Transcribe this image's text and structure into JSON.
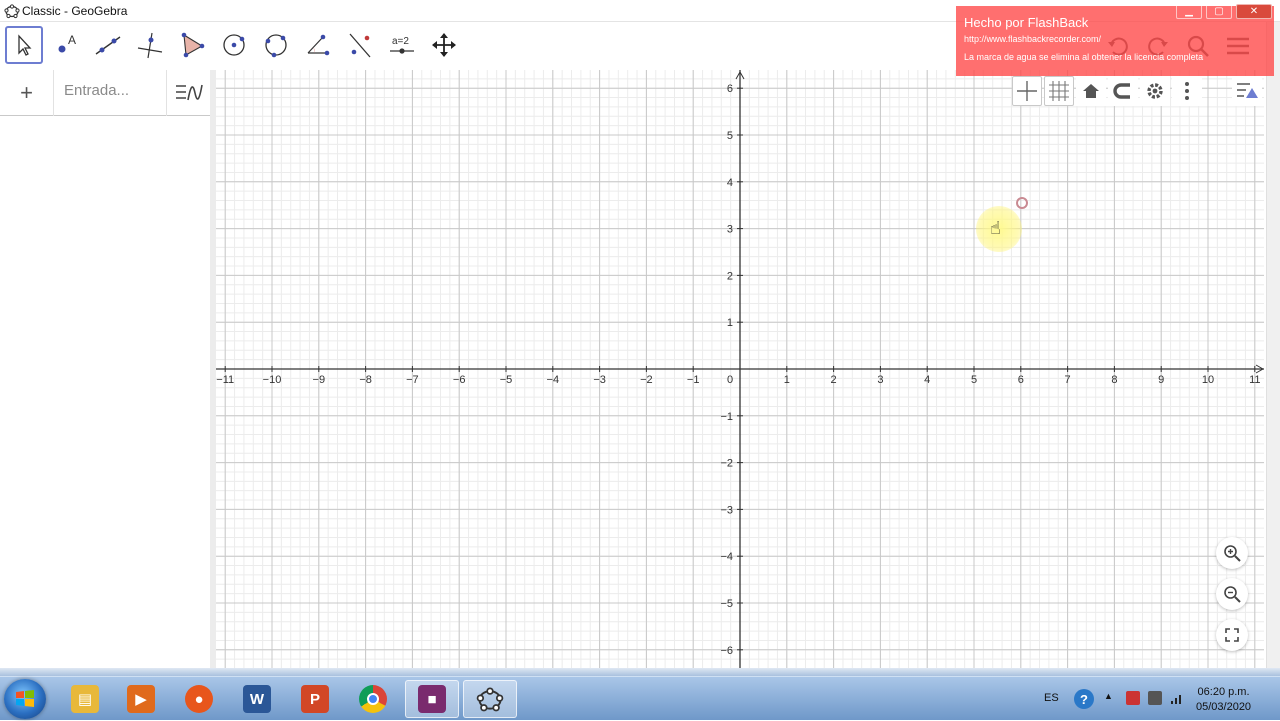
{
  "window": {
    "title": "Classic - GeoGebra"
  },
  "toolbar": {
    "tools": [
      {
        "name": "move-tool",
        "selected": true
      },
      {
        "name": "point-tool"
      },
      {
        "name": "line-tool"
      },
      {
        "name": "perpendicular-line-tool"
      },
      {
        "name": "polygon-tool"
      },
      {
        "name": "circle-center-point-tool"
      },
      {
        "name": "circle-three-points-tool"
      },
      {
        "name": "angle-tool"
      },
      {
        "name": "reflect-tool"
      },
      {
        "name": "slider-tool",
        "label": "a=2"
      },
      {
        "name": "move-graphics-view-tool"
      }
    ]
  },
  "algebra": {
    "add_label": "+",
    "input_placeholder": "Entrada..."
  },
  "graphics": {
    "x_ticks": [
      "−11",
      "−10",
      "−9",
      "−8",
      "−7",
      "−6",
      "−5",
      "−4",
      "−3",
      "−2",
      "−1",
      "0",
      "1",
      "2",
      "3",
      "4",
      "5",
      "6",
      "7",
      "8",
      "9",
      "10",
      "11"
    ],
    "y_ticks_pos": [
      "6",
      "5",
      "4",
      "3",
      "2",
      "1"
    ],
    "y_ticks_neg": [
      "−1",
      "−2",
      "−3",
      "−4",
      "−5",
      "−6"
    ]
  },
  "watermark": {
    "title": "Hecho por FlashBack",
    "url": "http://www.flashbackrecorder.com/",
    "note": "La marca de agua se elimina al obtener la licencia completa"
  },
  "taskbar": {
    "apps": [
      {
        "name": "file-explorer",
        "color": "#e8b83a"
      },
      {
        "name": "media-player",
        "color": "#e06a1c"
      },
      {
        "name": "firefox",
        "color": "#e8561c"
      },
      {
        "name": "word",
        "label": "W",
        "color": "#2b5797"
      },
      {
        "name": "powerpoint",
        "label": "P",
        "color": "#d24726"
      },
      {
        "name": "chrome",
        "color": "#3b8a3e"
      },
      {
        "name": "video-recorder",
        "color": "#7a2b6e"
      },
      {
        "name": "geogebra",
        "color": "#ffffff"
      }
    ],
    "language": "ES",
    "time": "06:20 p.m.",
    "date": "05/03/2020"
  },
  "colors": {
    "accent": "#6d7dd1",
    "axis": "#333333",
    "grid_major": "#c8c8c8",
    "grid_minor": "#ececec"
  }
}
